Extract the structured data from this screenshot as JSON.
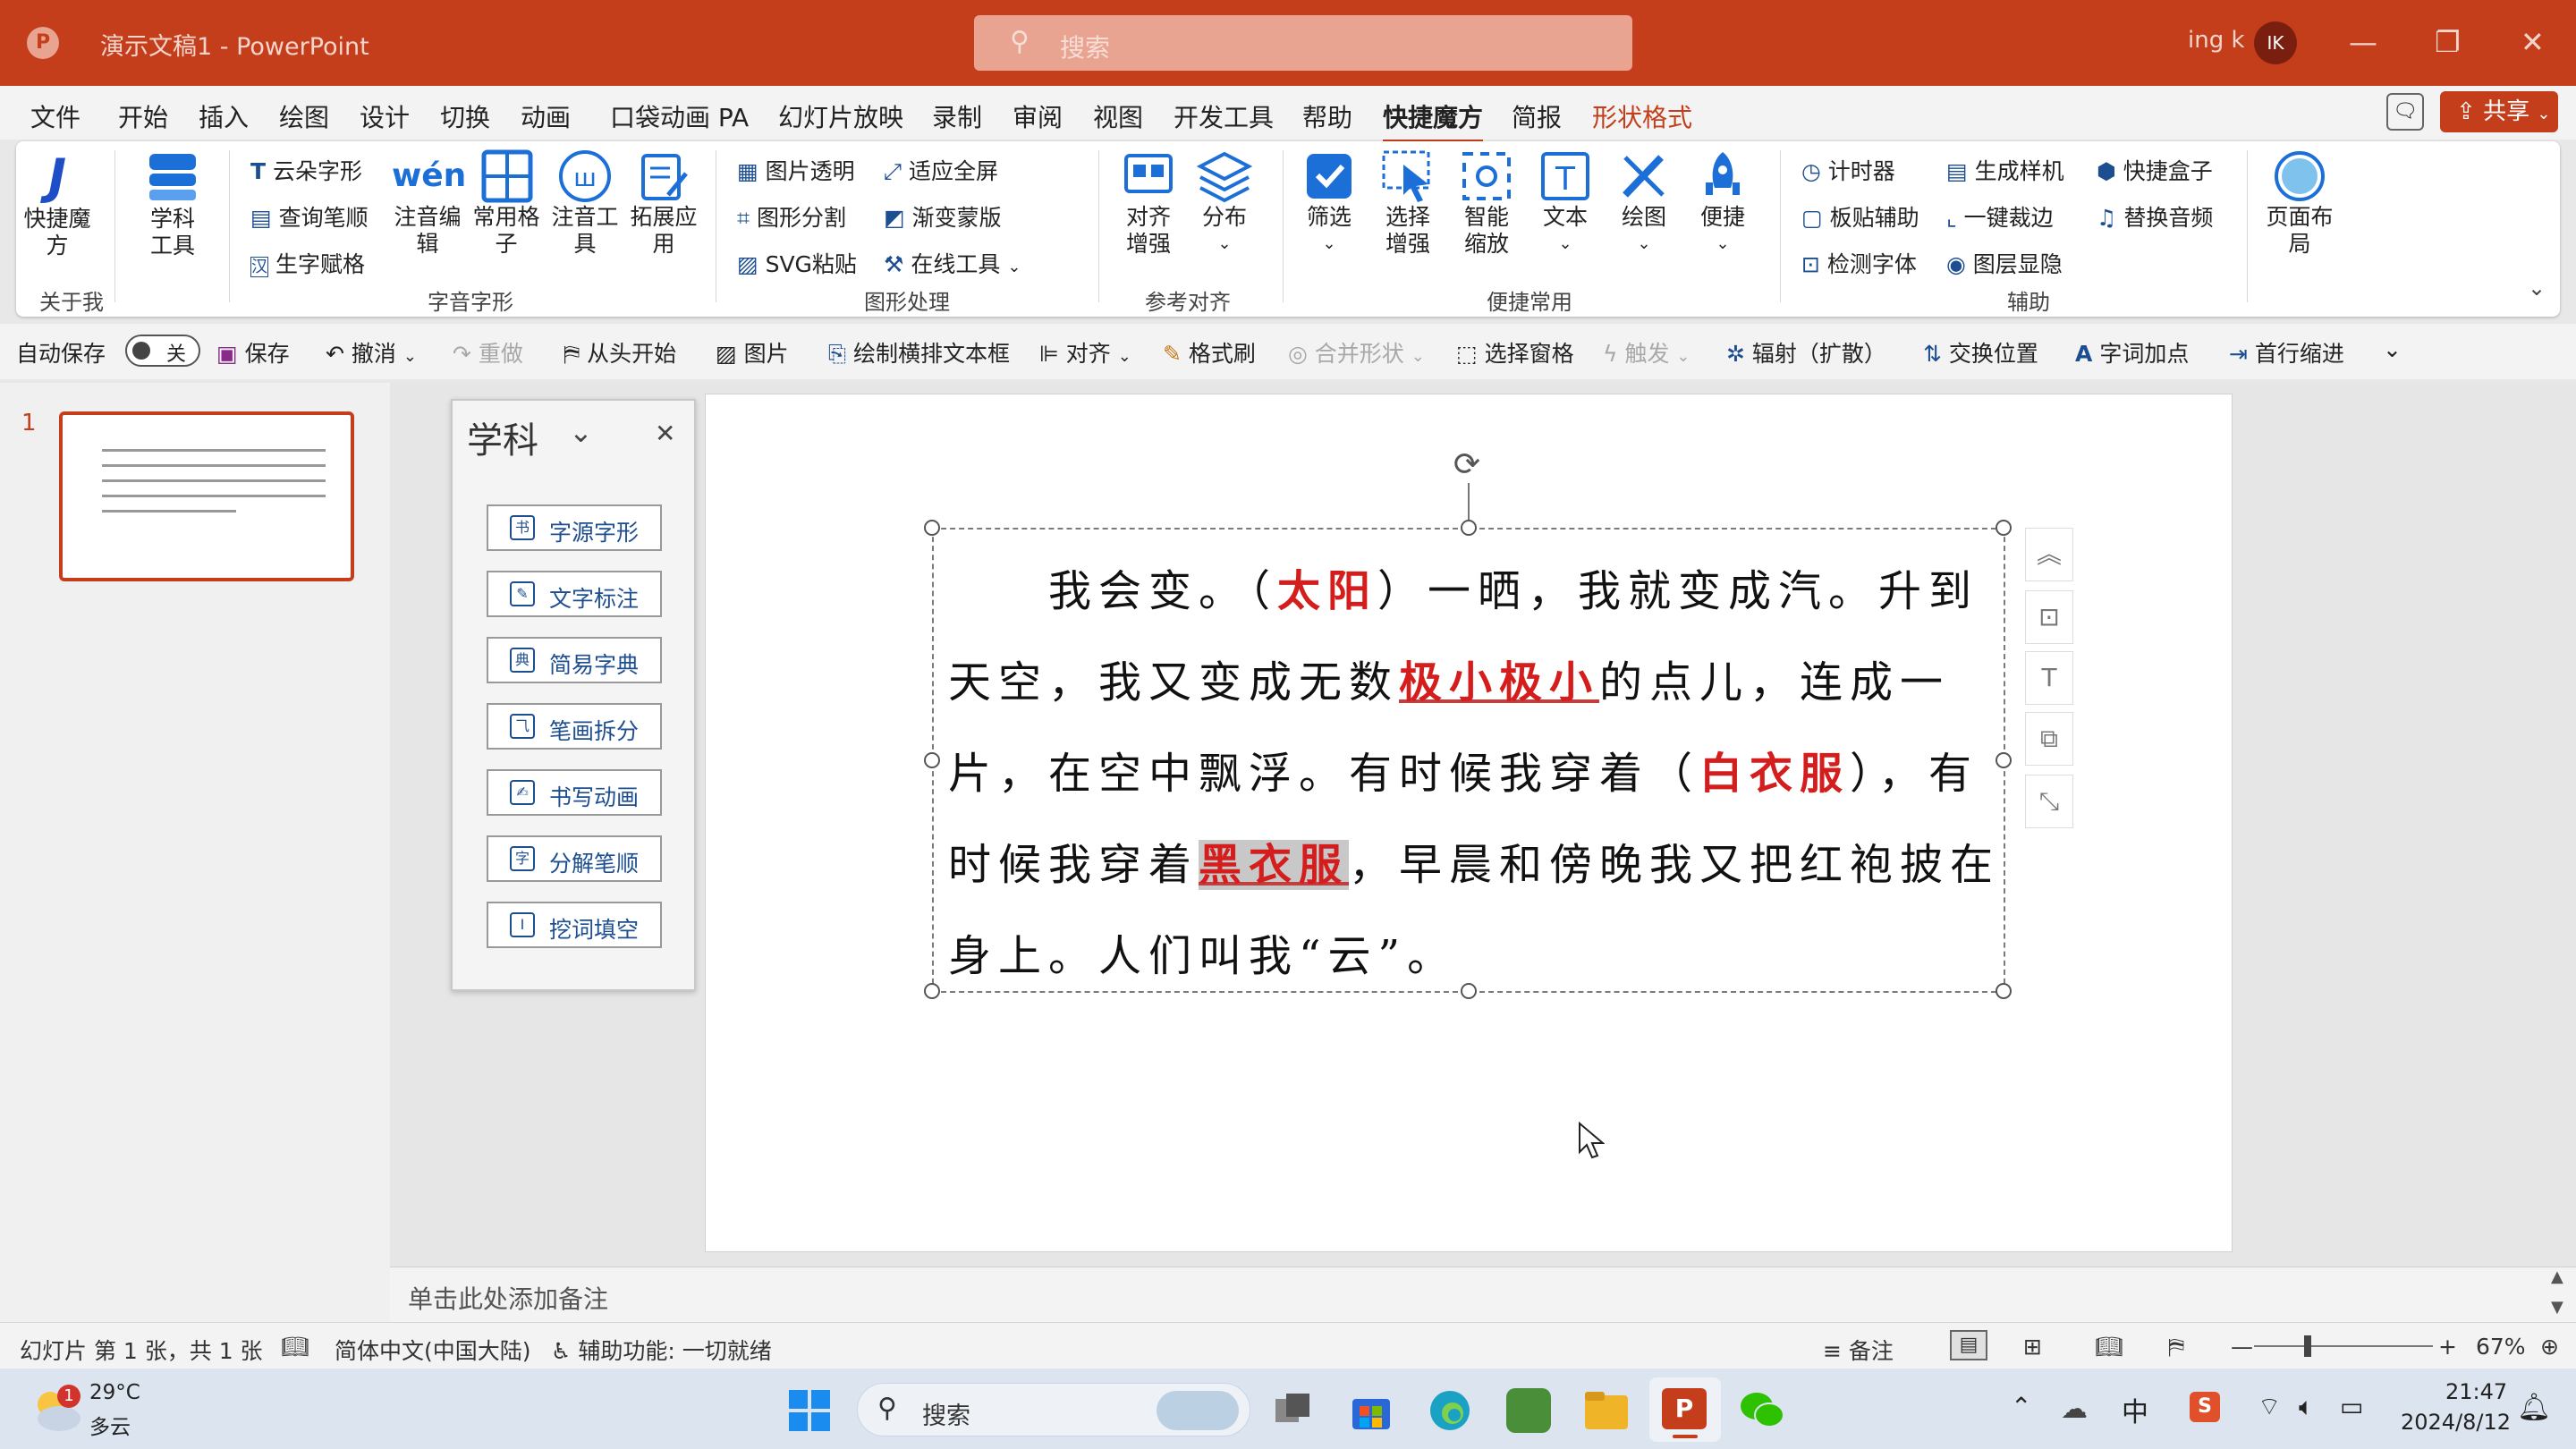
{
  "titlebar": {
    "doc_title": "演示文稿1 - PowerPoint",
    "search_placeholder": "搜索",
    "user_name": "ing k",
    "avatar_initials": "IK"
  },
  "menu": {
    "items": [
      "文件",
      "开始",
      "插入",
      "绘图",
      "设计",
      "切换",
      "动画",
      "口袋动画 PA",
      "幻灯片放映",
      "录制",
      "审阅",
      "视图",
      "开发工具",
      "帮助",
      "快捷魔方",
      "简报",
      "形状格式"
    ],
    "active": "快捷魔方",
    "share_label": "共享"
  },
  "ribbon": {
    "groups": {
      "about": {
        "label": "关于我",
        "kuaijie": "快捷魔\n方"
      },
      "xueke": {
        "label": "学科\n工具"
      },
      "ziyin": {
        "label": "字音字形",
        "yunduo": "云朵字形",
        "chaxun": "查询笔顺",
        "shengzi": "生字赋格",
        "zhuyin_bianji": "注音编\n辑",
        "changyong_gezi": "常用格\n子",
        "zhuyin_gongju": "注音工\n具",
        "tuozhan": "拓展应\n用"
      },
      "tuxing": {
        "label": "图形处理",
        "tupian_touming": "图片透明",
        "shiying": "适应全屏",
        "tuxing_fenge": "图形分割",
        "jianbian": "渐变蒙版",
        "svg": "SVG粘贴",
        "zaixian": "在线工具"
      },
      "cankao": {
        "label": "参考对齐",
        "duiqi": "对齐\n增强",
        "fenbu": "分布"
      },
      "bianjie": {
        "label": "便捷常用",
        "shaixuan": "筛选",
        "xuanze": "选择\n增强",
        "zhineng": "智能\n缩放",
        "wenben": "文本",
        "huitu": "绘图",
        "bianjie": "便捷"
      },
      "fuzhu": {
        "label": "辅助",
        "jishiqi": "计时器",
        "shengcheng": "生成样机",
        "kuaijie_hezi": "快捷盒子",
        "bantie": "板贴辅助",
        "yijian": "一键裁边",
        "tihuan": "替换音频",
        "jiance": "检测字体",
        "tuceng": "图层显隐",
        "yemian": "页面布\n局"
      }
    }
  },
  "qat": {
    "autosave": "自动保存",
    "autosave_state": "关",
    "save": "保存",
    "undo": "撤消",
    "redo": "重做",
    "from_start": "从头开始",
    "picture": "图片",
    "textbox": "绘制横排文本框",
    "align": "对齐",
    "format_painter": "格式刷",
    "merge": "合并形状",
    "selection_pane": "选择窗格",
    "trigger": "触发",
    "radiate": "辐射（扩散）",
    "swap": "交换位置",
    "emphasis": "字词加点",
    "indent": "首行缩进"
  },
  "thumbnail": {
    "number": "1"
  },
  "pane": {
    "title": "学科",
    "buttons": [
      {
        "label": "字源字形",
        "icon": "书"
      },
      {
        "label": "文字标注",
        "icon": "✎"
      },
      {
        "label": "简易字典",
        "icon": "典"
      },
      {
        "label": "笔画拆分",
        "icon": "⺄"
      },
      {
        "label": "书写动画",
        "icon": "✍"
      },
      {
        "label": "分解笔顺",
        "icon": "字"
      },
      {
        "label": "挖词填空",
        "icon": "I"
      }
    ]
  },
  "slide": {
    "seg1": "我会变。（",
    "red1": "太阳",
    "seg2": "）一晒，我就变成汽。升到天空，我又变成无数",
    "red2": "极小极小",
    "seg3": "的点儿，连成一片，在空中飘浮。有时候我穿着（",
    "red3": "白衣服",
    "seg4": "），有时候我穿着",
    "red4": "黑衣服",
    "seg5": "，早晨和傍晚我又把红袍披在身上。人们叫我“云”。"
  },
  "notes": {
    "placeholder": "单击此处添加备注"
  },
  "status": {
    "slide_info": "幻灯片 第 1 张，共 1 张",
    "language": "简体中文(中国大陆)",
    "accessibility": "辅助功能: 一切就绪",
    "notes_btn": "备注",
    "zoom": "67%"
  },
  "taskbar": {
    "temperature": "29°C",
    "weather": "多云",
    "weather_badge": "1",
    "search": "搜索",
    "ime": "中",
    "time": "21:47",
    "date": "2024/8/12"
  },
  "colors": {
    "accent": "#c43e1c",
    "red_text": "#d41d1d",
    "link_blue": "#1d4e8f"
  }
}
